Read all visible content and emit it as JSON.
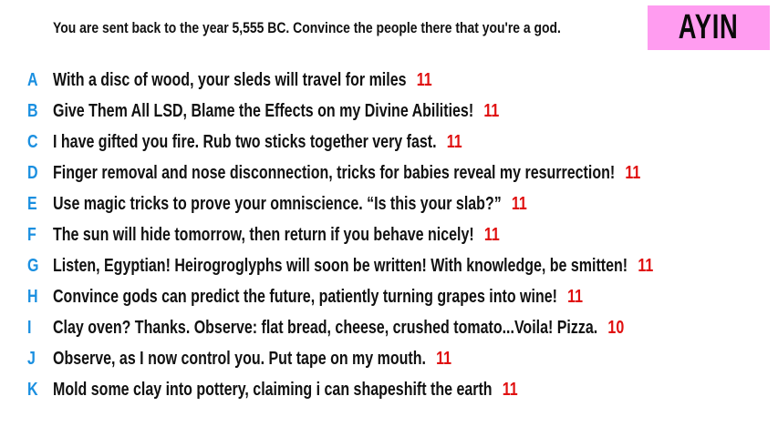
{
  "prompt": "You are sent back to the year 5,555 BC. Convince the people there that you're a god.",
  "player_name": "AYIN",
  "colors": {
    "badge": "#ff9cf0",
    "letter": "#1a8fe0",
    "score": "#e01010"
  },
  "answers": [
    {
      "letter": "A",
      "text": "With a disc of wood, your sleds will travel for miles",
      "score": "11"
    },
    {
      "letter": "B",
      "text": "Give Them All LSD, Blame the Effects on my Divine Abilities!",
      "score": "11"
    },
    {
      "letter": "C",
      "text": "I have gifted you fire. Rub two sticks together very fast.",
      "score": "11"
    },
    {
      "letter": "D",
      "text": "Finger removal and nose disconnection, tricks for babies reveal my resurrection!",
      "score": "11"
    },
    {
      "letter": "E",
      "text": "Use magic tricks to prove your omniscience. “Is this your slab?”",
      "score": "11"
    },
    {
      "letter": "F",
      "text": "The sun will hide tomorrow, then return if you behave nicely!",
      "score": "11"
    },
    {
      "letter": "G",
      "text": "Listen, Egyptian! Heirogroglyphs will soon be written! With knowledge, be smitten!",
      "score": "11"
    },
    {
      "letter": "H",
      "text": "Convince gods can predict the future, patiently turning grapes into wine!",
      "score": "11"
    },
    {
      "letter": "I",
      "text": "Clay oven? Thanks. Observe: flat bread, cheese, crushed tomato...Voila! Pizza.",
      "score": "10"
    },
    {
      "letter": "J",
      "text": "Observe, as I now control you. Put tape on my mouth.",
      "score": "11"
    },
    {
      "letter": "K",
      "text": "Mold some clay into pottery, claiming i can shapeshift the earth",
      "score": "11"
    }
  ]
}
